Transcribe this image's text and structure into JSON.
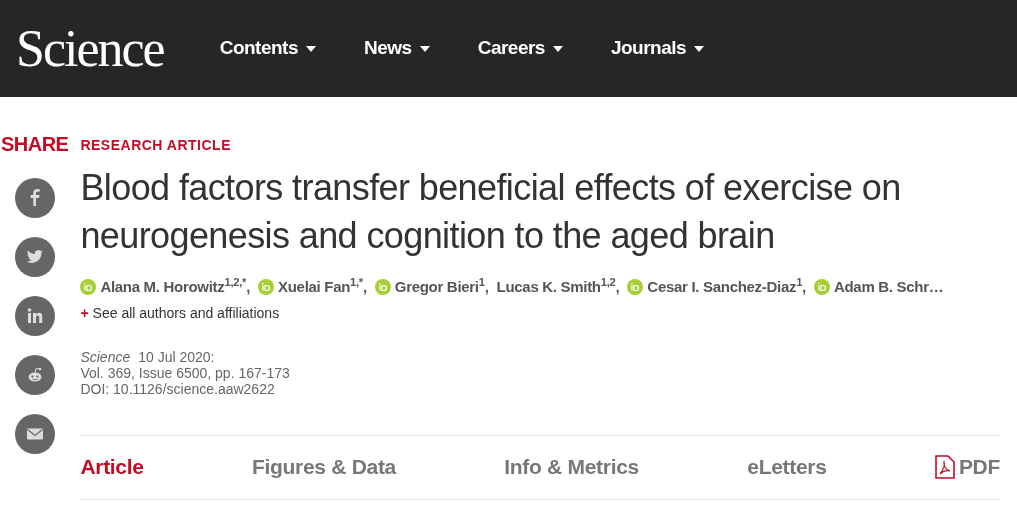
{
  "header": {
    "logo": "Science",
    "nav": [
      {
        "label": "Contents"
      },
      {
        "label": "News"
      },
      {
        "label": "Careers"
      },
      {
        "label": "Journals"
      }
    ]
  },
  "share": {
    "label": "SHARE",
    "buttons": [
      {
        "kind": "facebook"
      },
      {
        "kind": "twitter"
      },
      {
        "kind": "linkedin"
      },
      {
        "kind": "reddit"
      },
      {
        "kind": "email"
      }
    ]
  },
  "article": {
    "type": "RESEARCH ARTICLE",
    "title": "Blood factors transfer beneficial effects of exercise on neurogenesis and cognition to the aged brain",
    "authors": [
      {
        "name": "Alana M. Horowitz$^{1,2,*}$,",
        "orcid": true
      },
      {
        "name": "Xuelai Fan$^{1,*}$,",
        "orcid": true
      },
      {
        "name": "Gregor Bieri$^{1}$,",
        "orcid": true
      },
      {
        "name": "Lucas K. Smith$^{1,2}$,",
        "orcid": false
      },
      {
        "name": "Cesar I. Sanchez-Diaz$^{1}$,",
        "orcid": true
      },
      {
        "name": "Adam B. Schr…",
        "orcid": true
      }
    ],
    "see_all": {
      "icon": "+",
      "label": "See all authors and affiliations"
    },
    "journal": "Science",
    "date": "10 Jul 2020:",
    "volume": "Vol. 369, Issue 6500, pp. 167-173",
    "doi": "DOI: 10.1126/science.aaw2622"
  },
  "tabs": [
    {
      "label": "Article",
      "selected": true,
      "kind": "text"
    },
    {
      "label": "Figures & Data",
      "selected": false,
      "kind": "text"
    },
    {
      "label": "Info & Metrics",
      "selected": false,
      "kind": "text"
    },
    {
      "label": "eLetters",
      "selected": false,
      "kind": "text"
    },
    {
      "label": "PDF",
      "selected": false,
      "kind": "pdf"
    }
  ]
}
